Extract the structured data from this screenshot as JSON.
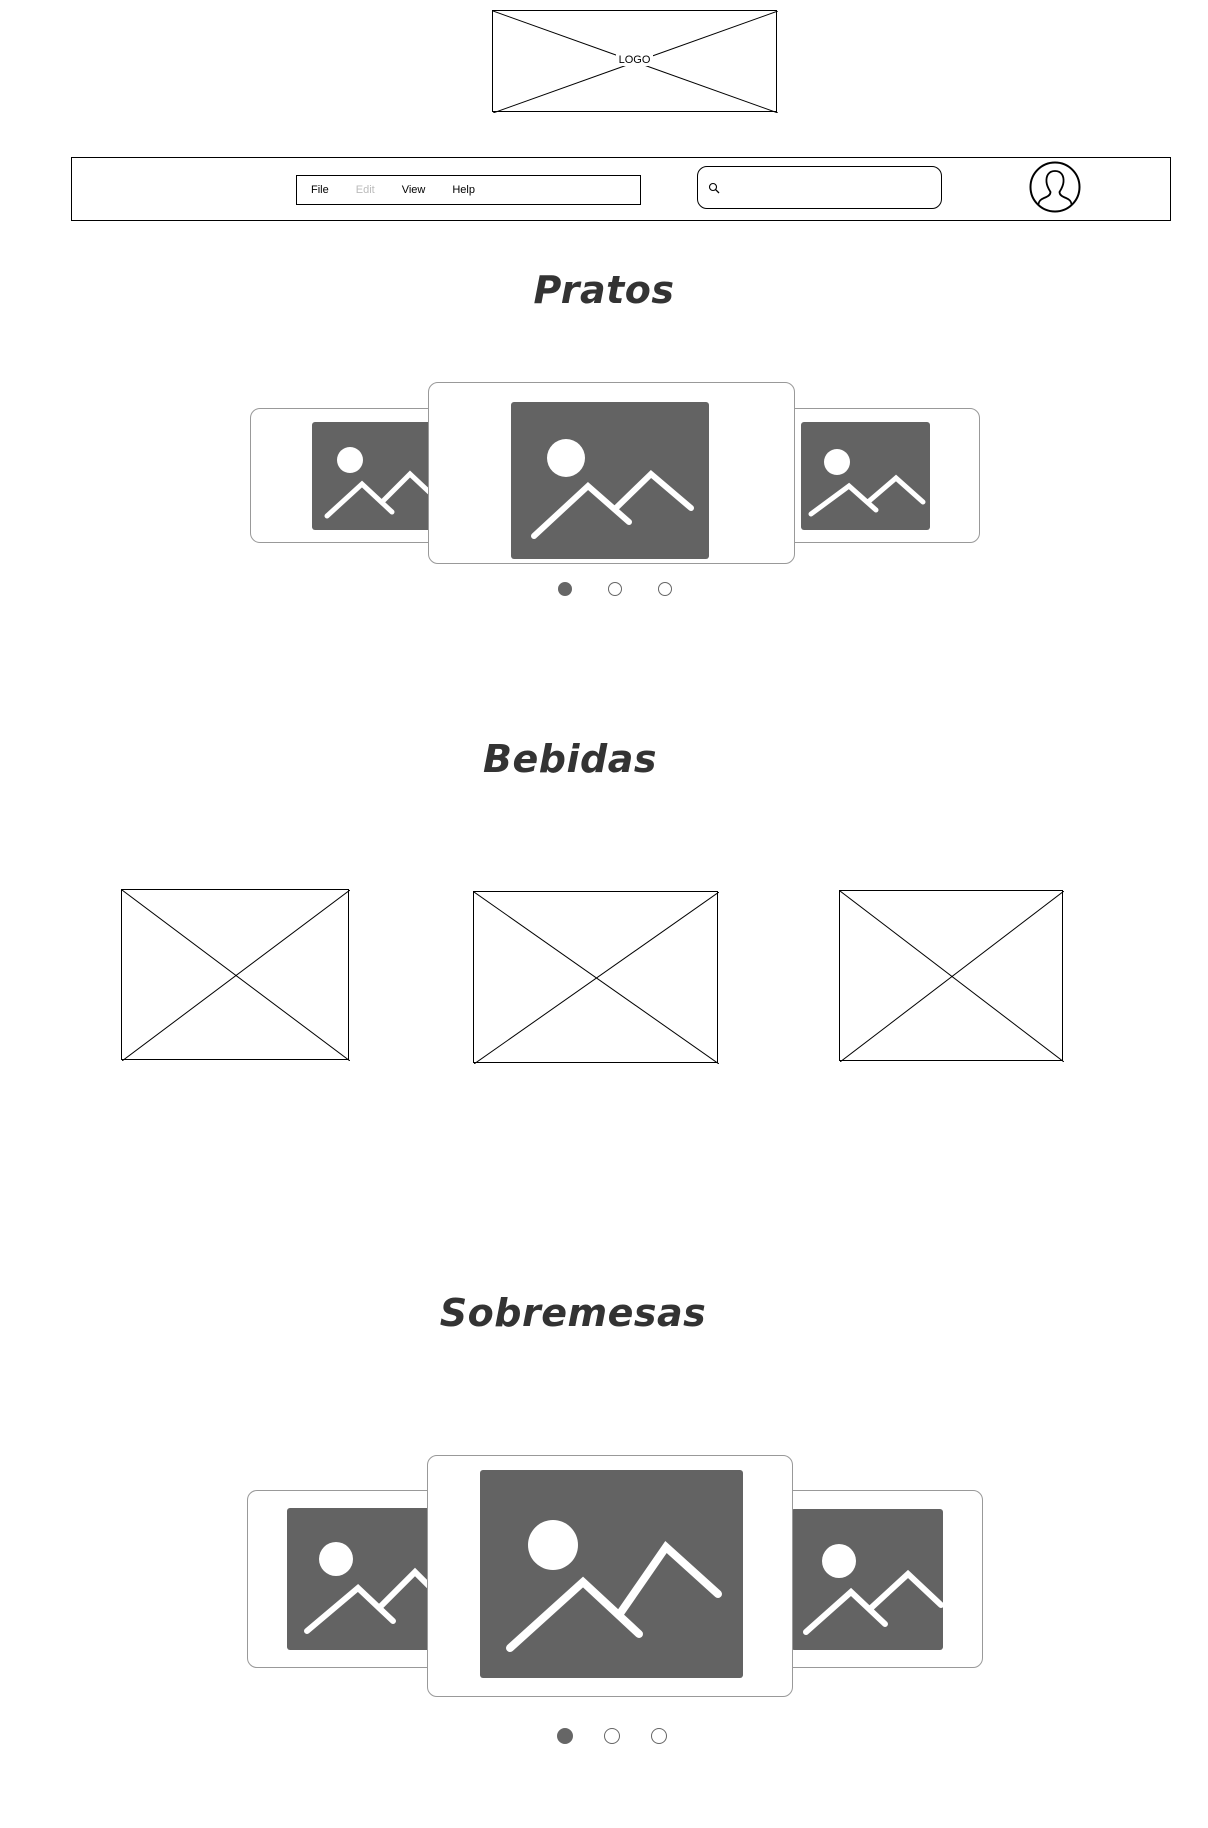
{
  "logo": {
    "text": "LOGO"
  },
  "menu": {
    "items": [
      {
        "label": "File",
        "enabled": true
      },
      {
        "label": "Edit",
        "enabled": false
      },
      {
        "label": "View",
        "enabled": true
      },
      {
        "label": "Help",
        "enabled": true
      }
    ]
  },
  "search": {
    "value": "",
    "icon": "search-icon"
  },
  "profile": {
    "icon": "user-avatar-icon"
  },
  "sections": {
    "pratos": {
      "title": "Pratos",
      "active_slide": 1,
      "slide_count": 3
    },
    "bebidas": {
      "title": "Bebidas",
      "placeholder_count": 3
    },
    "sobremesas": {
      "title": "Sobremesas",
      "active_slide": 1,
      "slide_count": 3
    }
  },
  "colors": {
    "image_fill": "#636363",
    "title": "#333333",
    "dot_active": "#666666",
    "disabled_text": "#bbbbbb"
  }
}
